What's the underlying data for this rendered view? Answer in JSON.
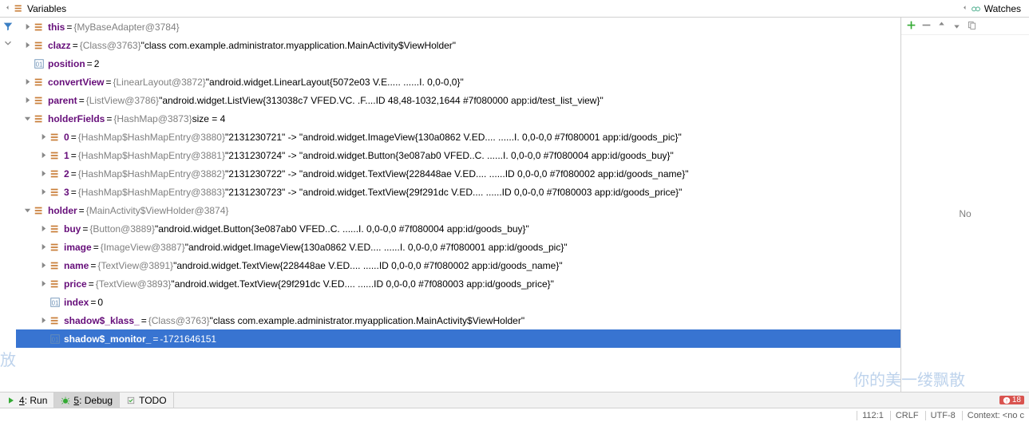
{
  "header": {
    "variables_tab": "Variables",
    "watches_tab": "Watches"
  },
  "watches": {
    "empty_text": "No"
  },
  "tree": [
    {
      "depth": 0,
      "expandable": true,
      "expanded": false,
      "icon": "obj",
      "name": "this",
      "type": "{MyBaseAdapter@3784}",
      "value": "",
      "selected": false
    },
    {
      "depth": 0,
      "expandable": true,
      "expanded": false,
      "icon": "obj",
      "name": "clazz",
      "type": "{Class@3763}",
      "value": "\"class com.example.administrator.myapplication.MainActivity$ViewHolder\"",
      "selected": false
    },
    {
      "depth": 0,
      "expandable": false,
      "expanded": false,
      "icon": "prim",
      "name": "position",
      "type": "",
      "value": "2",
      "selected": false
    },
    {
      "depth": 0,
      "expandable": true,
      "expanded": false,
      "icon": "obj",
      "name": "convertView",
      "type": "{LinearLayout@3872}",
      "value": "\"android.widget.LinearLayout{5072e03 V.E..... ......I. 0,0-0,0}\"",
      "selected": false
    },
    {
      "depth": 0,
      "expandable": true,
      "expanded": false,
      "icon": "obj",
      "name": "parent",
      "type": "{ListView@3786}",
      "value": "\"android.widget.ListView{313038c7 VFED.VC. .F....ID 48,48-1032,1644 #7f080000 app:id/test_list_view}\"",
      "selected": false
    },
    {
      "depth": 0,
      "expandable": true,
      "expanded": true,
      "icon": "obj",
      "name": "holderFields",
      "type": "{HashMap@3873}",
      "value": " size = 4",
      "selected": false
    },
    {
      "depth": 1,
      "expandable": true,
      "expanded": false,
      "icon": "obj",
      "name": "0",
      "type": "{HashMap$HashMapEntry@3880}",
      "value": "\"2131230721\" -> \"android.widget.ImageView{130a0862 V.ED.... ......I. 0,0-0,0 #7f080001 app:id/goods_pic}\"",
      "selected": false
    },
    {
      "depth": 1,
      "expandable": true,
      "expanded": false,
      "icon": "obj",
      "name": "1",
      "type": "{HashMap$HashMapEntry@3881}",
      "value": "\"2131230724\" -> \"android.widget.Button{3e087ab0 VFED..C. ......I. 0,0-0,0 #7f080004 app:id/goods_buy}\"",
      "selected": false
    },
    {
      "depth": 1,
      "expandable": true,
      "expanded": false,
      "icon": "obj",
      "name": "2",
      "type": "{HashMap$HashMapEntry@3882}",
      "value": "\"2131230722\" -> \"android.widget.TextView{228448ae V.ED.... ......ID 0,0-0,0 #7f080002 app:id/goods_name}\"",
      "selected": false
    },
    {
      "depth": 1,
      "expandable": true,
      "expanded": false,
      "icon": "obj",
      "name": "3",
      "type": "{HashMap$HashMapEntry@3883}",
      "value": "\"2131230723\" -> \"android.widget.TextView{29f291dc V.ED.... ......ID 0,0-0,0 #7f080003 app:id/goods_price}\"",
      "selected": false
    },
    {
      "depth": 0,
      "expandable": true,
      "expanded": true,
      "icon": "obj",
      "name": "holder",
      "type": "{MainActivity$ViewHolder@3874}",
      "value": "",
      "selected": false
    },
    {
      "depth": 1,
      "expandable": true,
      "expanded": false,
      "icon": "obj",
      "name": "buy",
      "type": "{Button@3889}",
      "value": "\"android.widget.Button{3e087ab0 VFED..C. ......I. 0,0-0,0 #7f080004 app:id/goods_buy}\"",
      "selected": false
    },
    {
      "depth": 1,
      "expandable": true,
      "expanded": false,
      "icon": "obj",
      "name": "image",
      "type": "{ImageView@3887}",
      "value": "\"android.widget.ImageView{130a0862 V.ED.... ......I. 0,0-0,0 #7f080001 app:id/goods_pic}\"",
      "selected": false
    },
    {
      "depth": 1,
      "expandable": true,
      "expanded": false,
      "icon": "obj",
      "name": "name",
      "type": "{TextView@3891}",
      "value": "\"android.widget.TextView{228448ae V.ED.... ......ID 0,0-0,0 #7f080002 app:id/goods_name}\"",
      "selected": false
    },
    {
      "depth": 1,
      "expandable": true,
      "expanded": false,
      "icon": "obj",
      "name": "price",
      "type": "{TextView@3893}",
      "value": "\"android.widget.TextView{29f291dc V.ED.... ......ID 0,0-0,0 #7f080003 app:id/goods_price}\"",
      "selected": false
    },
    {
      "depth": 1,
      "expandable": false,
      "expanded": false,
      "icon": "prim",
      "name": "index",
      "type": "",
      "value": "0",
      "selected": false
    },
    {
      "depth": 1,
      "expandable": true,
      "expanded": false,
      "icon": "obj",
      "name": "shadow$_klass_",
      "type": "{Class@3763}",
      "value": "\"class com.example.administrator.myapplication.MainActivity$ViewHolder\"",
      "selected": false
    },
    {
      "depth": 1,
      "expandable": false,
      "expanded": false,
      "icon": "prim",
      "name": "shadow$_monitor_",
      "type": "",
      "value": "-1721646151",
      "selected": true
    }
  ],
  "bottom_tabs": {
    "run": {
      "prefix": "4",
      "label": ": Run"
    },
    "debug": {
      "prefix": "5",
      "label": ": Debug"
    },
    "todo": "TODO",
    "error_count": "18"
  },
  "status_bar": {
    "pos": "112:1",
    "crlf": "CRLF",
    "encoding": "UTF-8",
    "context": "Context: <no c"
  },
  "watermarks": {
    "left": "放",
    "right": "你的美一缕飘散"
  }
}
